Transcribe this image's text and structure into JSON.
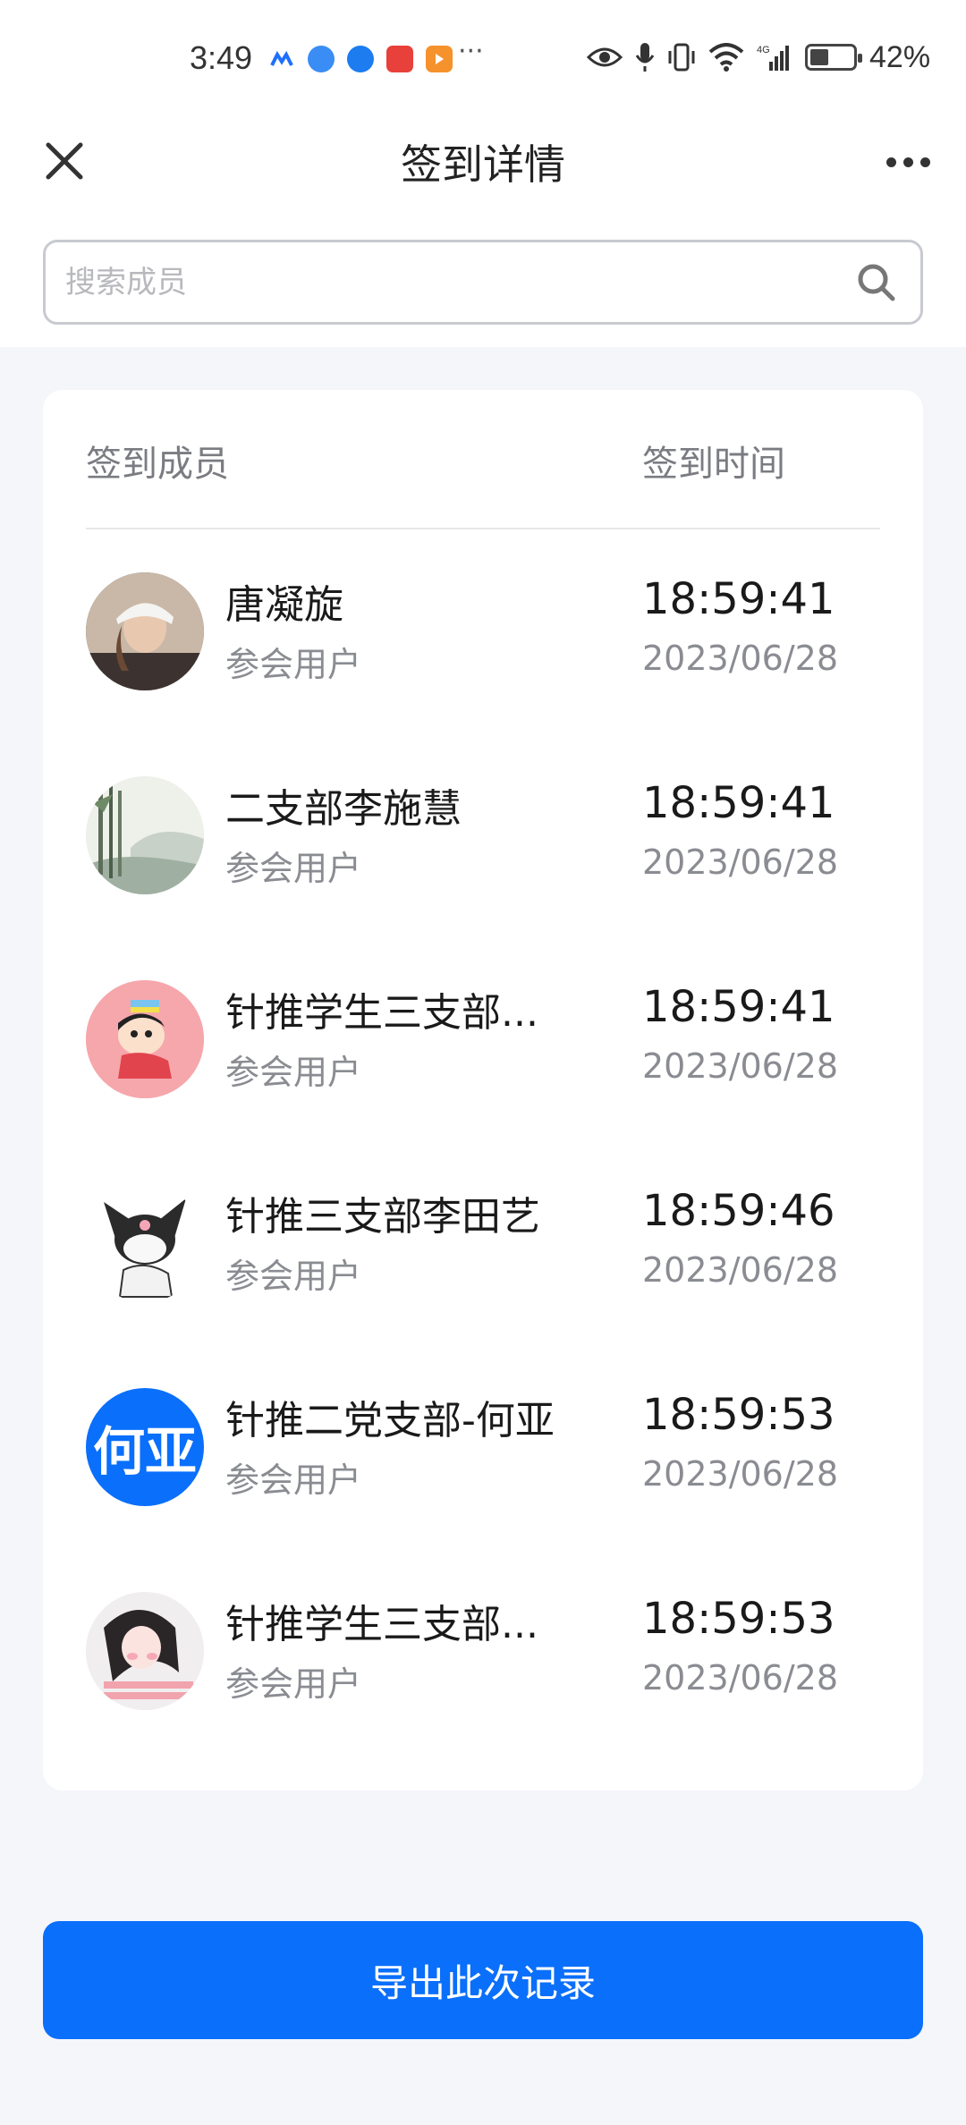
{
  "status_bar": {
    "time": "3:49",
    "battery": "42%",
    "network": "4G",
    "more": "···"
  },
  "header": {
    "title": "签到详情"
  },
  "search": {
    "placeholder": "搜索成员",
    "value": ""
  },
  "table": {
    "col_member": "签到成员",
    "col_time": "签到时间",
    "rows": [
      {
        "name": "唐凝旋",
        "role": "参会用户",
        "time": "18:59:41",
        "date": "2023/06/28",
        "avatar": "photo-woman-cap"
      },
      {
        "name": "二支部李施慧",
        "role": "参会用户",
        "time": "18:59:41",
        "date": "2023/06/28",
        "avatar": "landscape-painting"
      },
      {
        "name": "针推学生三支部...",
        "role": "参会用户",
        "time": "18:59:41",
        "date": "2023/06/28",
        "avatar": "cartoon-boy-pink"
      },
      {
        "name": "针推三支部李田艺",
        "role": "参会用户",
        "time": "18:59:46",
        "date": "2023/06/28",
        "avatar": "cartoon-kuromi"
      },
      {
        "name": "针推二党支部-何亚",
        "role": "参会用户",
        "time": "18:59:53",
        "date": "2023/06/28",
        "avatar": "text-avatar",
        "avatar_text": "何亚"
      },
      {
        "name": "针推学生三支部...",
        "role": "参会用户",
        "time": "18:59:53",
        "date": "2023/06/28",
        "avatar": "illustration-girl"
      }
    ]
  },
  "export_label": "导出此次记录",
  "colors": {
    "accent": "#0a6ffb",
    "background": "#f5f6fa",
    "muted_text": "#8a8c92"
  }
}
